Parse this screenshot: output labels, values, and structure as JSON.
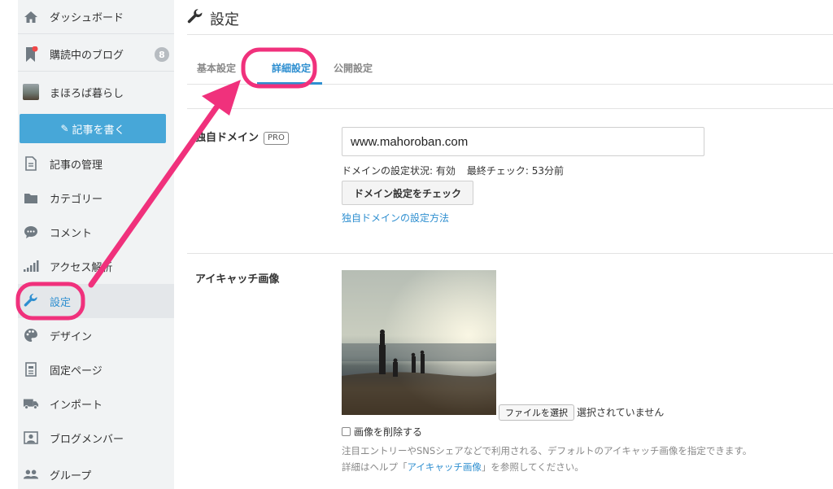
{
  "sidebar": {
    "items": [
      {
        "label": "ダッシュボード",
        "icon": "home-icon"
      },
      {
        "label": "購読中のブログ",
        "icon": "bookmark-icon",
        "badge": "8"
      },
      {
        "label": "まほろば暮らし",
        "icon": "blog-avatar"
      },
      {
        "label": "記事の管理",
        "icon": "document-icon"
      },
      {
        "label": "カテゴリー",
        "icon": "folder-icon"
      },
      {
        "label": "コメント",
        "icon": "comment-icon"
      },
      {
        "label": "アクセス解析",
        "icon": "bar-chart-icon"
      },
      {
        "label": "設定",
        "icon": "wrench-icon"
      },
      {
        "label": "デザイン",
        "icon": "palette-icon"
      },
      {
        "label": "固定ページ",
        "icon": "page-icon"
      },
      {
        "label": "インポート",
        "icon": "truck-icon"
      },
      {
        "label": "ブログメンバー",
        "icon": "member-icon"
      },
      {
        "label": "グループ",
        "icon": "group-icon"
      }
    ],
    "write_button": "記事を書く"
  },
  "page": {
    "title": "設定",
    "tabs": [
      {
        "label": "基本設定",
        "active": false
      },
      {
        "label": "詳細設定",
        "active": true
      },
      {
        "label": "公開設定",
        "active": false
      }
    ]
  },
  "domain": {
    "label": "独自ドメイン",
    "pro_badge": "PRO",
    "value": "www.mahoroban.com",
    "status_text": "ドメインの設定状況: 有効",
    "last_check": "最終チェック: 53分前",
    "check_button": "ドメイン設定をチェック",
    "howto_link": "独自ドメインの設定方法"
  },
  "eyecatch": {
    "label": "アイキャッチ画像",
    "file_button": "ファイルを選択",
    "file_status": "選択されていません",
    "delete_label": "画像を削除する",
    "note_line1": "注目エントリーやSNSシェアなどで利用される、デフォルトのアイキャッチ画像を指定できます。",
    "note_line2_prefix": "詳細はヘルプ「",
    "note_line2_link": "アイキャッチ画像",
    "note_line2_suffix": "」を参照してください。"
  },
  "colors": {
    "accent": "#2f8fd0",
    "write_button": "#47a7d8",
    "annotation": "#f0317c"
  }
}
